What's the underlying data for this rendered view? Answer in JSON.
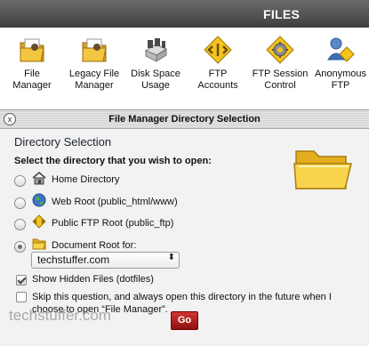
{
  "header": {
    "title": "FILES"
  },
  "tools": [
    {
      "label": "File\nManager",
      "icon": "file-manager-icon"
    },
    {
      "label": "Legacy File\nManager",
      "icon": "legacy-file-manager-icon"
    },
    {
      "label": "Disk Space\nUsage",
      "icon": "disk-space-icon"
    },
    {
      "label": "FTP\nAccounts",
      "icon": "ftp-accounts-icon"
    },
    {
      "label": "FTP Session\nControl",
      "icon": "ftp-session-control-icon"
    },
    {
      "label": "Anonymous\nFTP",
      "icon": "anonymous-ftp-icon"
    }
  ],
  "dialog": {
    "title": "File Manager Directory Selection",
    "close_label": "x",
    "section_heading": "Directory Selection",
    "subheading": "Select the directory that you wish to open:",
    "options": [
      {
        "label": "Home Directory",
        "icon": "home-icon",
        "selected": false
      },
      {
        "label": "Web Root (public_html/www)",
        "icon": "globe-icon",
        "selected": false
      },
      {
        "label": "Public FTP Root (public_ftp)",
        "icon": "ftp-icon",
        "selected": false
      },
      {
        "label": "Document Root for:",
        "icon": "folder-icon",
        "selected": true
      }
    ],
    "domain_select": {
      "value": "techstuffer.com"
    },
    "show_hidden": {
      "label": "Show Hidden Files (dotfiles)",
      "checked": true
    },
    "skip": {
      "label": "Skip this question, and always open this directory in the future when I choose to open “File Manager”.",
      "checked": false
    },
    "go_label": "Go"
  },
  "watermark": "techstuffer.com",
  "colors": {
    "header": "#4a4a4a",
    "go_button": "#b31f1f",
    "dialog_bg": "#f2f2f2"
  }
}
